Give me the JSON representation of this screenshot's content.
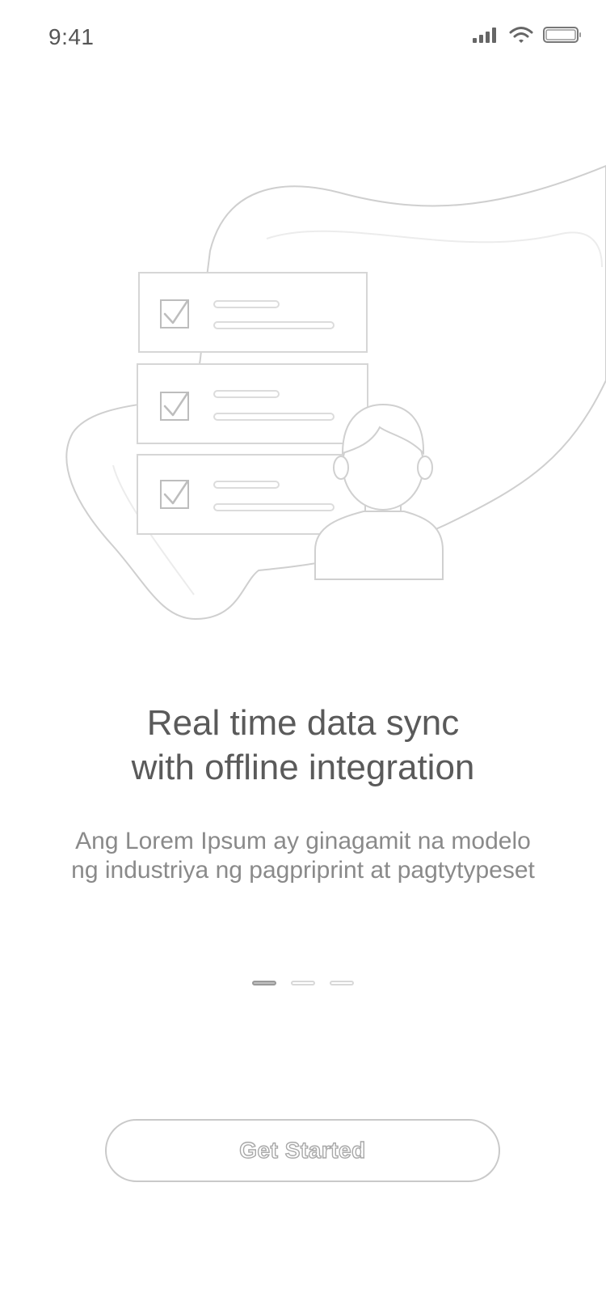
{
  "status_bar": {
    "time": "9:41",
    "icons": [
      "cellular-signal-icon",
      "wifi-icon",
      "battery-icon"
    ]
  },
  "onboarding": {
    "illustration_icon": "checklist-person-illustration",
    "title_line1": "Real time data sync",
    "title_line2": "with offline integration",
    "description": "Ang Lorem Ipsum ay ginagamit na modelo ng industriya ng pagpriprint at pagtytypeset",
    "pages_total": 3,
    "current_page": 1
  },
  "cta": {
    "label": "Get Started"
  },
  "colors": {
    "background": "#ffffff",
    "text_primary": "#5a5a5a",
    "text_secondary": "#8a8a8a",
    "outline": "#c9c9c9"
  }
}
